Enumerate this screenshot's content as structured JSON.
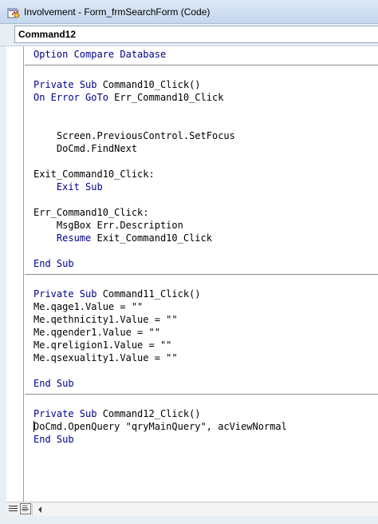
{
  "window": {
    "title": "Involvement - Form_frmSearchForm (Code)",
    "icon": "vba-code-window-icon"
  },
  "object_selector": {
    "value": "Command12"
  },
  "colors": {
    "keyword": "#00008b",
    "text": "#000000",
    "title_bar": "#c4d7ee"
  },
  "code": {
    "procedures": [
      {
        "lines": [
          {
            "keyword": "Option Compare Database",
            "rest": ""
          }
        ]
      },
      {
        "lines": [
          {
            "keyword": "Private Sub",
            "rest": " Command10_Click()"
          },
          {
            "keyword": "On Error GoTo",
            "rest": " Err_Command10_Click"
          },
          {
            "keyword": "",
            "rest": ""
          },
          {
            "keyword": "",
            "rest": ""
          },
          {
            "keyword": "",
            "rest": "    Screen.PreviousControl.SetFocus"
          },
          {
            "keyword": "",
            "rest": "    DoCmd.FindNext"
          },
          {
            "keyword": "",
            "rest": ""
          },
          {
            "keyword": "",
            "rest": "Exit_Command10_Click:"
          },
          {
            "keyword": "    Exit Sub",
            "rest": ""
          },
          {
            "keyword": "",
            "rest": ""
          },
          {
            "keyword": "",
            "rest": "Err_Command10_Click:"
          },
          {
            "keyword": "",
            "rest": "    MsgBox Err.Description"
          },
          {
            "keyword": "    Resume",
            "rest": " Exit_Command10_Click"
          },
          {
            "keyword": "",
            "rest": ""
          },
          {
            "keyword": "End Sub",
            "rest": ""
          }
        ]
      },
      {
        "lines": [
          {
            "keyword": "Private Sub",
            "rest": " Command11_Click()"
          },
          {
            "keyword": "",
            "rest": "Me.qage1.Value = \"\""
          },
          {
            "keyword": "",
            "rest": "Me.qethnicity1.Value = \"\""
          },
          {
            "keyword": "",
            "rest": "Me.qgender1.Value = \"\""
          },
          {
            "keyword": "",
            "rest": "Me.qreligion1.Value = \"\""
          },
          {
            "keyword": "",
            "rest": "Me.qsexuality1.Value = \"\""
          },
          {
            "keyword": "",
            "rest": ""
          },
          {
            "keyword": "End Sub",
            "rest": ""
          }
        ]
      },
      {
        "lines": [
          {
            "keyword": "Private Sub",
            "rest": " Command12_Click()"
          },
          {
            "keyword": "",
            "rest": "DoCmd.OpenQuery \"qryMainQuery\", acViewNormal"
          },
          {
            "keyword": "End Sub",
            "rest": ""
          }
        ]
      }
    ]
  },
  "statusbar": {
    "procedure_view_icon": "procedure-view-icon",
    "full_module_view_icon": "full-module-view-icon",
    "scroll_left_icon": "scroll-left-arrow-icon"
  }
}
